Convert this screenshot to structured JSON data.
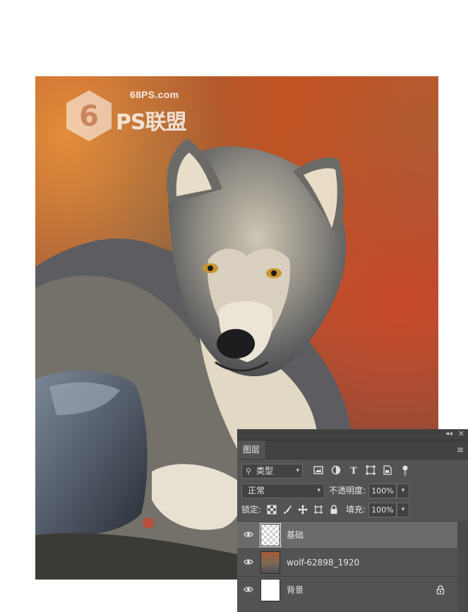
{
  "watermark": {
    "domain": "68PS.com",
    "text": "PS联盟"
  },
  "panel": {
    "tab_label": "图层",
    "kind_filter": {
      "label": "类型"
    },
    "filter_icons": [
      "image-filter-icon",
      "adjustment-filter-icon",
      "type-filter-icon",
      "shape-filter-icon",
      "smart-object-filter-icon",
      "filter-toggle-icon"
    ],
    "blend_mode": "正常",
    "opacity_label": "不透明度:",
    "opacity_value": "100%",
    "lock_label": "锁定:",
    "lock_icons": [
      "lock-transparent-icon",
      "lock-paint-icon",
      "lock-position-icon",
      "lock-artboard-icon",
      "lock-all-icon"
    ],
    "fill_label": "填充:",
    "fill_value": "100%",
    "layers": [
      {
        "name": "基础",
        "thumb": "transparent",
        "selected": true,
        "locked": false
      },
      {
        "name": "wolf-62898_1920",
        "thumb": "photo",
        "selected": false,
        "locked": false
      },
      {
        "name": "背景",
        "thumb": "white",
        "selected": false,
        "locked": true
      }
    ]
  },
  "colors": {
    "panel_bg": "#535353",
    "panel_header": "#424242",
    "selected_layer": "#6a6a6a"
  }
}
